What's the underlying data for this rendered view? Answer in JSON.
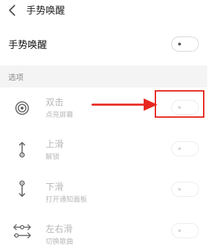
{
  "header": {
    "title": "手势唤醒",
    "back_icon": "chevron-left-icon"
  },
  "main_toggle": {
    "label": "手势唤醒",
    "state": "off"
  },
  "section": {
    "label": "选项"
  },
  "options": [
    {
      "label": "双击",
      "sub": "点亮屏幕",
      "icon": "double-tap-icon",
      "state": "off"
    },
    {
      "label": "上滑",
      "sub": "解锁",
      "icon": "swipe-up-icon",
      "state": "off"
    },
    {
      "label": "下滑",
      "sub": "打开通知面板",
      "icon": "swipe-down-icon",
      "state": "off"
    },
    {
      "label": "左右滑",
      "sub": "切换歌曲",
      "icon": "swipe-left-right-icon",
      "state": "off"
    }
  ],
  "annotation": {
    "color": "#e8261f"
  }
}
